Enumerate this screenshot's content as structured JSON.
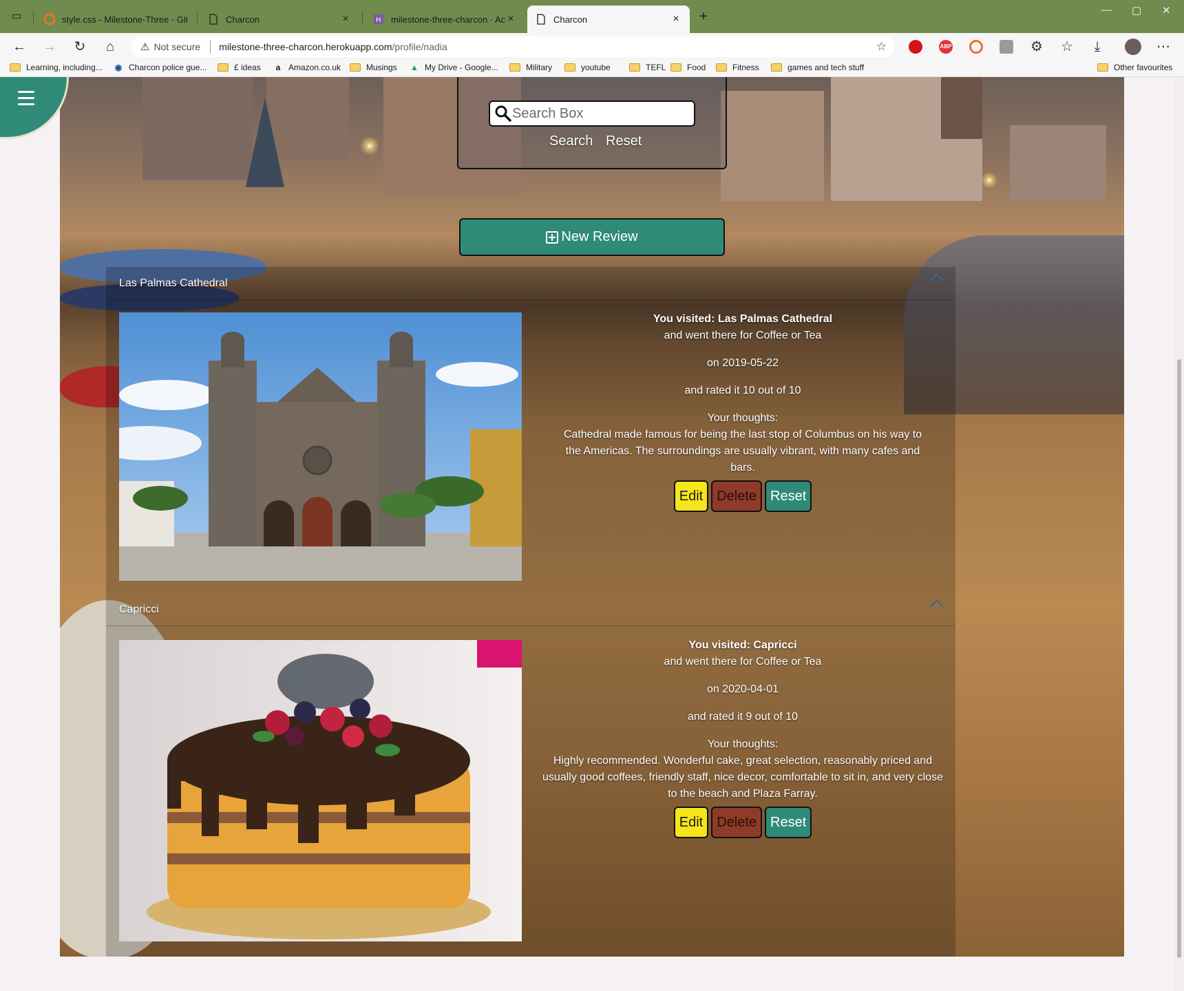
{
  "browser": {
    "tabs": [
      {
        "title": "style.css - Milestone-Three - Gitp",
        "icon": "gitpod-icon"
      },
      {
        "title": "Charcon",
        "icon": "page-icon"
      },
      {
        "title": "milestone-three-charcon · Activit",
        "icon": "heroku-icon"
      },
      {
        "title": "Charcon",
        "icon": "page-icon",
        "active": true
      }
    ],
    "not_secure": "Not secure",
    "url_host": "milestone-three-charcon.herokuapp.com",
    "url_path": "/profile/nadia",
    "bookmarks": [
      "Learning, including...",
      "Charcon police gue...",
      "£ ideas",
      "Amazon.co.uk",
      "Musings",
      "My Drive - Google...",
      "Military",
      "youtube",
      "TEFL",
      "Food",
      "Fitness",
      "games and tech stuff"
    ],
    "other_favourites": "Other favourites"
  },
  "search": {
    "placeholder": "Search Box",
    "search_label": "Search",
    "reset_label": "Reset"
  },
  "new_review_label": "New Review",
  "reviews": [
    {
      "header": "Las Palmas Cathedral",
      "visited": "You visited: Las Palmas Cathedral",
      "purpose": "and went there for Coffee or Tea",
      "date": "on 2019-05-22",
      "rating": "and rated it 10 out of 10",
      "thoughts_label": "Your thoughts:",
      "thoughts": "Cathedral made famous for being the last stop of Columbus on his way to the Americas. The surroundings are usually vibrant, with many cafes and bars.",
      "edit": "Edit",
      "delete": "Delete",
      "reset": "Reset"
    },
    {
      "header": "Capricci",
      "visited": "You visited: Capricci",
      "purpose": "and went there for Coffee or Tea",
      "date": "on 2020-04-01",
      "rating": "and rated it 9 out of 10",
      "thoughts_label": "Your thoughts:",
      "thoughts": "Highly recommended. Wonderful cake, great selection, reasonably priced and usually good coffees, friendly staff, nice decor, comfortable to sit in, and very close to the beach and Plaza Farray.",
      "edit": "Edit",
      "delete": "Delete",
      "reset": "Reset"
    }
  ],
  "colors": {
    "accent": "#2f8a78",
    "edit": "#f5e51a",
    "delete": "#8e3b2a",
    "tabbar": "#708b4e"
  }
}
